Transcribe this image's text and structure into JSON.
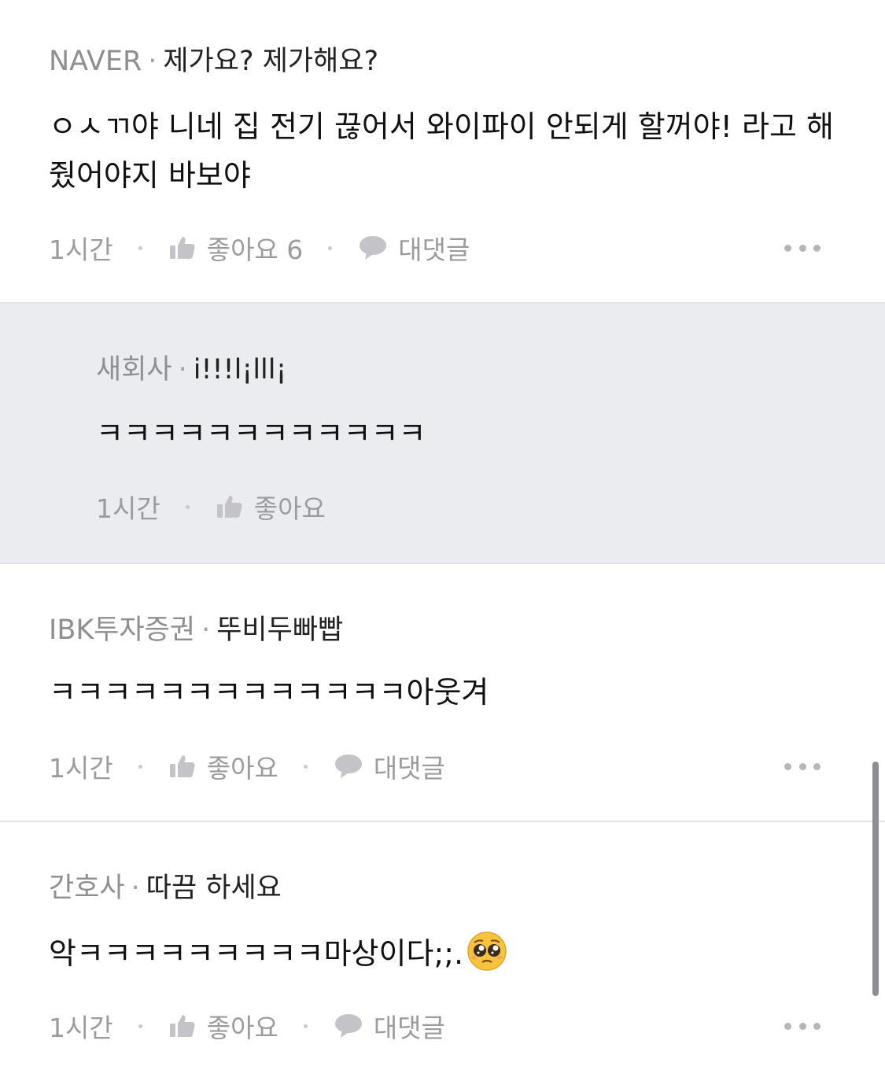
{
  "comments": [
    {
      "company": "NAVER",
      "separator": "·",
      "nickname": "제가요? 제가해요?",
      "text": "ㅇㅅㄲ야 니네 집 전기 끊어서 와이파이 안되게 할꺼야! 라고 해줬어야지 바보야",
      "time": "1시간",
      "like_label": "좋아요 6",
      "reply_label": "대댓글"
    },
    {
      "company": "새회사",
      "separator": "·",
      "nickname": "i!!!l¡lll¡",
      "text": "ㅋㅋㅋㅋㅋㅋㅋㅋㅋㅋㅋㅋ",
      "time": "1시간",
      "like_label": "좋아요"
    },
    {
      "company": "IBK투자증권",
      "separator": "·",
      "nickname": "뚜비두빠빱",
      "text": "ㅋㅋㅋㅋㅋㅋㅋㅋㅋㅋㅋㅋㅋ아웃겨",
      "time": "1시간",
      "like_label": "좋아요",
      "reply_label": "대댓글"
    },
    {
      "company": "간호사",
      "separator": "·",
      "nickname": "따끔 하세요",
      "text": "악ㅋㅋㅋㅋㅋㅋㅋㅋㅋ마상이다;;.",
      "emoji": "pleading-face-emoji",
      "time": "1시간",
      "like_label": "좋아요",
      "reply_label": "대댓글"
    }
  ],
  "icons": {
    "like": "thumbs-up-icon",
    "reply": "speech-bubble-icon",
    "more": "ellipsis-icon"
  },
  "colors": {
    "reply_background": "#ebecf0",
    "meta_text": "#9a9a9f",
    "company_text": "#8e8e93"
  }
}
